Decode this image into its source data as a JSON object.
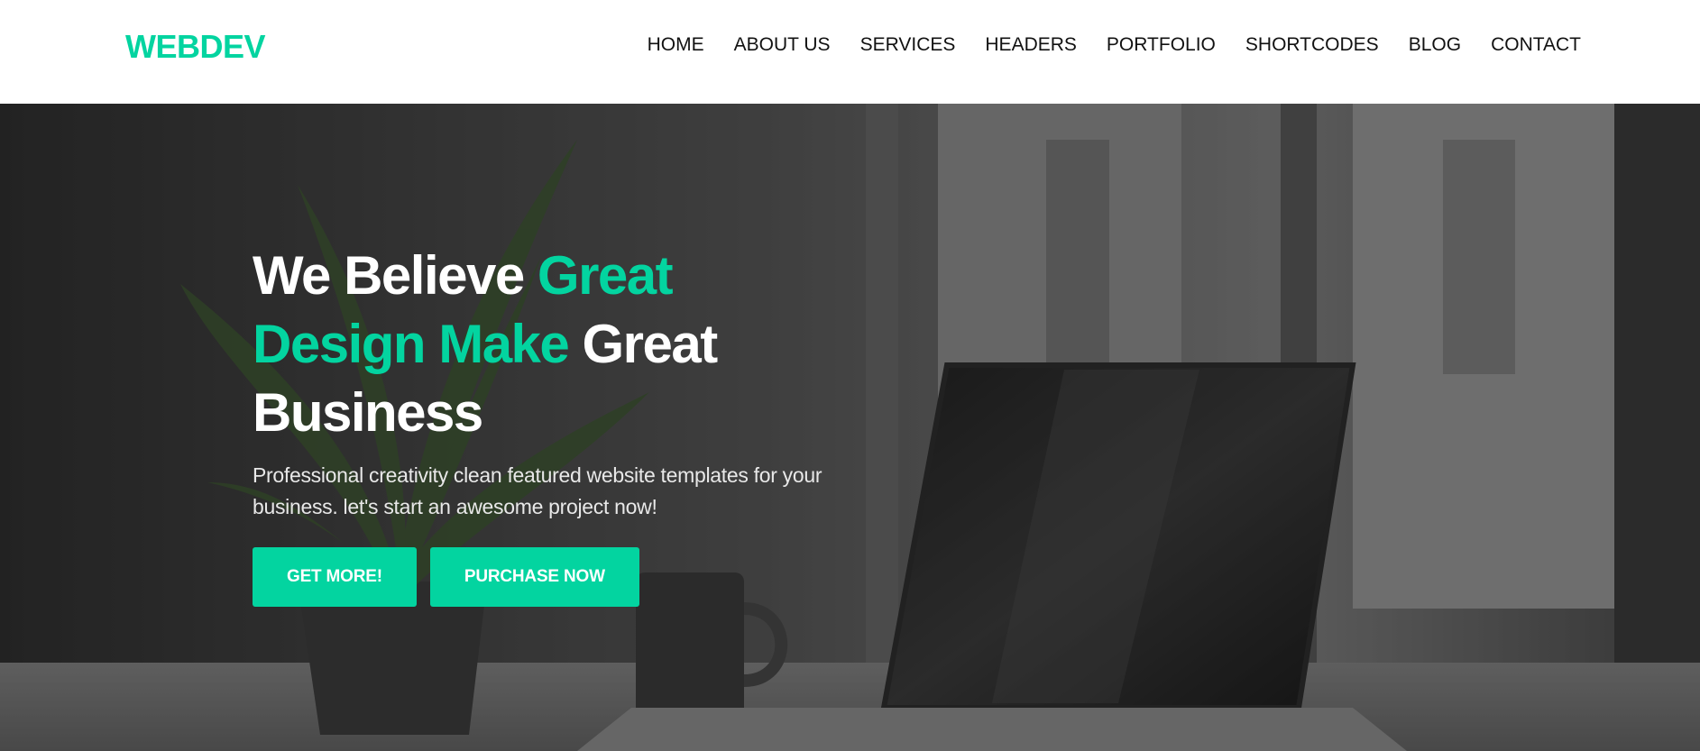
{
  "brand": {
    "logo": "WEBDEV",
    "accent_color": "#03d4a0"
  },
  "nav": {
    "items": [
      {
        "label": "HOME"
      },
      {
        "label": "ABOUT US"
      },
      {
        "label": "SERVICES"
      },
      {
        "label": "HEADERS"
      },
      {
        "label": "PORTFOLIO"
      },
      {
        "label": "SHORTCODES"
      },
      {
        "label": "BLOG"
      },
      {
        "label": "CONTACT"
      }
    ]
  },
  "hero": {
    "headline": {
      "part1": "We Believe ",
      "part2": "Great",
      "part3": "Design Make",
      "part4": " Great",
      "part5": "Business"
    },
    "subtitle": "Professional creativity clean featured website templates for your business. let's start an awesome project now!",
    "buttons": {
      "primary": "GET MORE!",
      "secondary": "PURCHASE NOW"
    }
  }
}
